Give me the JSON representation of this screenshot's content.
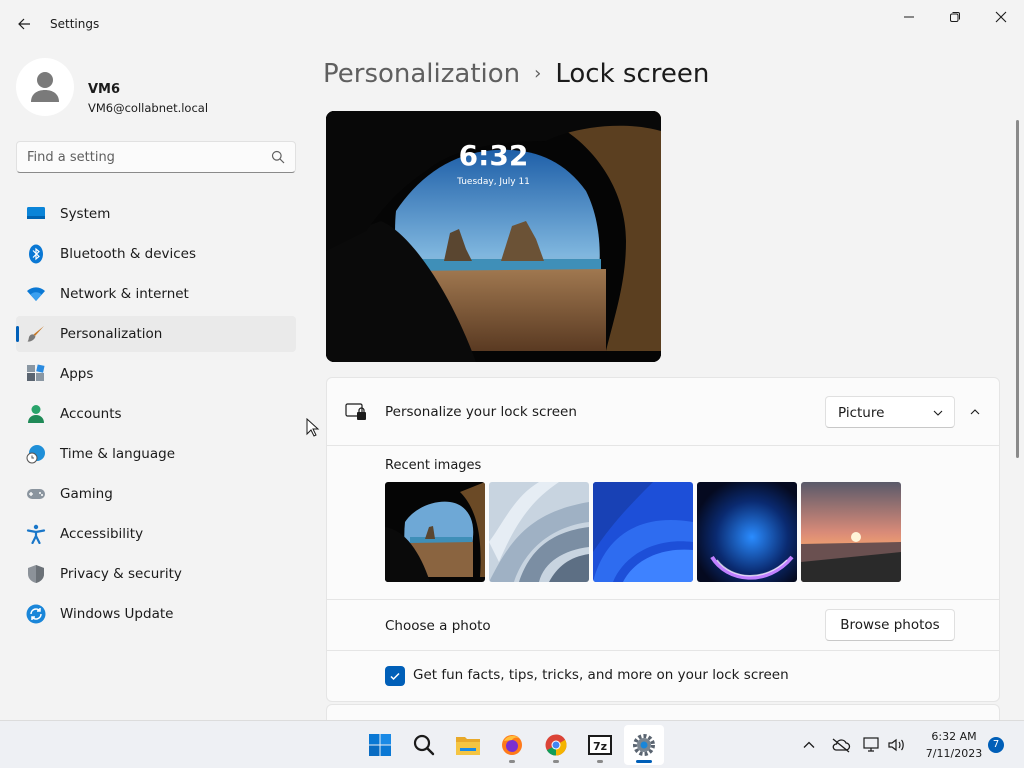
{
  "window": {
    "title": "Settings",
    "back_icon": "back-arrow-icon",
    "controls": [
      "minimize-icon",
      "restore-icon",
      "close-icon"
    ]
  },
  "profile": {
    "name": "VM6",
    "email": "VM6@collabnet.local"
  },
  "search": {
    "placeholder": "Find a setting"
  },
  "sidebar": {
    "items": [
      {
        "label": "System",
        "icon": "system-icon",
        "active": false
      },
      {
        "label": "Bluetooth & devices",
        "icon": "bluetooth-icon",
        "active": false
      },
      {
        "label": "Network & internet",
        "icon": "wifi-icon",
        "active": false
      },
      {
        "label": "Personalization",
        "icon": "brush-icon",
        "active": true
      },
      {
        "label": "Apps",
        "icon": "apps-icon",
        "active": false
      },
      {
        "label": "Accounts",
        "icon": "accounts-icon",
        "active": false
      },
      {
        "label": "Time & language",
        "icon": "globe-clock-icon",
        "active": false
      },
      {
        "label": "Gaming",
        "icon": "gamepad-icon",
        "active": false
      },
      {
        "label": "Accessibility",
        "icon": "accessibility-icon",
        "active": false
      },
      {
        "label": "Privacy & security",
        "icon": "shield-icon",
        "active": false
      },
      {
        "label": "Windows Update",
        "icon": "update-icon",
        "active": false
      }
    ]
  },
  "breadcrumb": {
    "parent": "Personalization",
    "separator": "›",
    "current": "Lock screen"
  },
  "preview": {
    "time": "6:32",
    "date": "Tuesday, July 11"
  },
  "lock_card": {
    "title": "Personalize your lock screen",
    "dropdown_value": "Picture",
    "recent_label": "Recent images",
    "choose_label": "Choose a photo",
    "browse_label": "Browse photos",
    "facts_label": "Get fun facts, tips, tricks, and more on your lock screen",
    "facts_checked": true
  },
  "taskbar": {
    "apps": [
      "windows-start-icon",
      "search-icon",
      "file-explorer-icon",
      "firefox-icon",
      "chrome-icon",
      "7zip-icon",
      "settings-icon"
    ],
    "active_app": "settings-icon",
    "time": "6:32 AM",
    "date": "7/11/2023",
    "notifications": "7"
  },
  "colors": {
    "accent": "#005fb8",
    "background": "#f3f3f3",
    "card": "#fbfbfb"
  }
}
